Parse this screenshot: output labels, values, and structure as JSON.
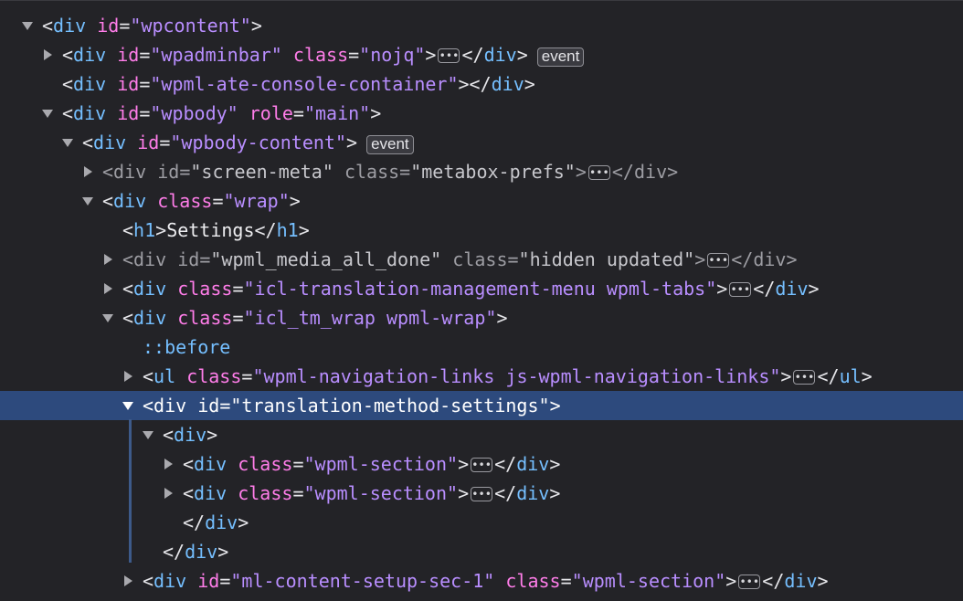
{
  "badges": {
    "event": "event"
  },
  "rows": [
    {
      "indent": 24,
      "twisty": "down",
      "dim": false,
      "selected": false,
      "parts": [
        [
          "b",
          "<"
        ],
        [
          "t",
          "div"
        ],
        [
          "s",
          " "
        ],
        [
          "a",
          "id"
        ],
        [
          "e",
          "="
        ],
        [
          "v",
          "\"wpcontent\""
        ],
        [
          "b",
          ">"
        ]
      ]
    },
    {
      "indent": 46,
      "twisty": "right",
      "dim": false,
      "selected": false,
      "parts": [
        [
          "b",
          "<"
        ],
        [
          "t",
          "div"
        ],
        [
          "s",
          " "
        ],
        [
          "a",
          "id"
        ],
        [
          "e",
          "="
        ],
        [
          "v",
          "\"wpadminbar\""
        ],
        [
          "s",
          " "
        ],
        [
          "a",
          "class"
        ],
        [
          "e",
          "="
        ],
        [
          "v",
          "\"nojq\""
        ],
        [
          "b",
          ">"
        ],
        [
          "ell",
          ""
        ],
        [
          "b",
          "</"
        ],
        [
          "t",
          "div"
        ],
        [
          "b",
          ">"
        ],
        [
          "badge",
          "event"
        ]
      ]
    },
    {
      "indent": 46,
      "twisty": "none",
      "dim": false,
      "selected": false,
      "parts": [
        [
          "b",
          "<"
        ],
        [
          "t",
          "div"
        ],
        [
          "s",
          " "
        ],
        [
          "a",
          "id"
        ],
        [
          "e",
          "="
        ],
        [
          "v",
          "\"wpml-ate-console-container\""
        ],
        [
          "b",
          "></"
        ],
        [
          "t",
          "div"
        ],
        [
          "b",
          ">"
        ]
      ]
    },
    {
      "indent": 46,
      "twisty": "down",
      "dim": false,
      "selected": false,
      "parts": [
        [
          "b",
          "<"
        ],
        [
          "t",
          "div"
        ],
        [
          "s",
          " "
        ],
        [
          "a",
          "id"
        ],
        [
          "e",
          "="
        ],
        [
          "v",
          "\"wpbody\""
        ],
        [
          "s",
          " "
        ],
        [
          "a",
          "role"
        ],
        [
          "e",
          "="
        ],
        [
          "v",
          "\"main\""
        ],
        [
          "b",
          ">"
        ]
      ]
    },
    {
      "indent": 68,
      "twisty": "down",
      "dim": false,
      "selected": false,
      "parts": [
        [
          "b",
          "<"
        ],
        [
          "t",
          "div"
        ],
        [
          "s",
          " "
        ],
        [
          "a",
          "id"
        ],
        [
          "e",
          "="
        ],
        [
          "v",
          "\"wpbody-content\""
        ],
        [
          "b",
          ">"
        ],
        [
          "badge",
          "event"
        ]
      ]
    },
    {
      "indent": 90,
      "twisty": "right",
      "dim": true,
      "selected": false,
      "parts": [
        [
          "b",
          "<"
        ],
        [
          "t",
          "div"
        ],
        [
          "s",
          " "
        ],
        [
          "a",
          "id"
        ],
        [
          "e",
          "="
        ],
        [
          "vd",
          "\"screen-meta\""
        ],
        [
          "s",
          " "
        ],
        [
          "a",
          "class"
        ],
        [
          "e",
          "="
        ],
        [
          "vd",
          "\"metabox-prefs\""
        ],
        [
          "b",
          ">"
        ],
        [
          "ell",
          ""
        ],
        [
          "b",
          "</"
        ],
        [
          "t",
          "div"
        ],
        [
          "b",
          ">"
        ]
      ]
    },
    {
      "indent": 90,
      "twisty": "down",
      "dim": false,
      "selected": false,
      "parts": [
        [
          "b",
          "<"
        ],
        [
          "t",
          "div"
        ],
        [
          "s",
          " "
        ],
        [
          "a",
          "class"
        ],
        [
          "e",
          "="
        ],
        [
          "v",
          "\"wrap\""
        ],
        [
          "b",
          ">"
        ]
      ]
    },
    {
      "indent": 112,
      "twisty": "none",
      "dim": false,
      "selected": false,
      "parts": [
        [
          "b",
          "<"
        ],
        [
          "t",
          "h1"
        ],
        [
          "b",
          ">"
        ],
        [
          "x",
          "Settings"
        ],
        [
          "b",
          "</"
        ],
        [
          "t",
          "h1"
        ],
        [
          "b",
          ">"
        ]
      ]
    },
    {
      "indent": 112,
      "twisty": "right",
      "dim": true,
      "selected": false,
      "parts": [
        [
          "b",
          "<"
        ],
        [
          "t",
          "div"
        ],
        [
          "s",
          " "
        ],
        [
          "a",
          "id"
        ],
        [
          "e",
          "="
        ],
        [
          "vd",
          "\"wpml_media_all_done\""
        ],
        [
          "s",
          " "
        ],
        [
          "a",
          "class"
        ],
        [
          "e",
          "="
        ],
        [
          "vd",
          "\"hidden updated\""
        ],
        [
          "b",
          ">"
        ],
        [
          "ell",
          ""
        ],
        [
          "b",
          "</"
        ],
        [
          "t",
          "div"
        ],
        [
          "b",
          ">"
        ]
      ]
    },
    {
      "indent": 112,
      "twisty": "right",
      "dim": false,
      "selected": false,
      "parts": [
        [
          "b",
          "<"
        ],
        [
          "t",
          "div"
        ],
        [
          "s",
          " "
        ],
        [
          "a",
          "class"
        ],
        [
          "e",
          "="
        ],
        [
          "v",
          "\"icl-translation-management-menu wpml-tabs\""
        ],
        [
          "b",
          ">"
        ],
        [
          "ell",
          ""
        ],
        [
          "b",
          "</"
        ],
        [
          "t",
          "div"
        ],
        [
          "b",
          ">"
        ]
      ]
    },
    {
      "indent": 112,
      "twisty": "down",
      "dim": false,
      "selected": false,
      "parts": [
        [
          "b",
          "<"
        ],
        [
          "t",
          "div"
        ],
        [
          "s",
          " "
        ],
        [
          "a",
          "class"
        ],
        [
          "e",
          "="
        ],
        [
          "v",
          "\"icl_tm_wrap wpml-wrap\""
        ],
        [
          "b",
          ">"
        ]
      ]
    },
    {
      "indent": 134,
      "twisty": "none",
      "dim": false,
      "selected": false,
      "parts": [
        [
          "p",
          "::before"
        ]
      ]
    },
    {
      "indent": 134,
      "twisty": "right",
      "dim": false,
      "selected": false,
      "parts": [
        [
          "b",
          "<"
        ],
        [
          "t",
          "ul"
        ],
        [
          "s",
          " "
        ],
        [
          "a",
          "class"
        ],
        [
          "e",
          "="
        ],
        [
          "v",
          "\"wpml-navigation-links js-wpml-navigation-links\""
        ],
        [
          "b",
          ">"
        ],
        [
          "ell",
          ""
        ],
        [
          "b",
          "</"
        ],
        [
          "t",
          "ul"
        ],
        [
          "b",
          ">"
        ]
      ]
    },
    {
      "indent": 134,
      "twisty": "down",
      "dim": false,
      "selected": true,
      "parts": [
        [
          "b",
          "<"
        ],
        [
          "t",
          "div"
        ],
        [
          "s",
          " "
        ],
        [
          "a",
          "id"
        ],
        [
          "e",
          "="
        ],
        [
          "v",
          "\"translation-method-settings\""
        ],
        [
          "b",
          ">"
        ]
      ]
    },
    {
      "indent": 156,
      "twisty": "down",
      "dim": false,
      "selected": false,
      "parts": [
        [
          "b",
          "<"
        ],
        [
          "t",
          "div"
        ],
        [
          "b",
          ">"
        ]
      ]
    },
    {
      "indent": 178,
      "twisty": "right",
      "dim": false,
      "selected": false,
      "parts": [
        [
          "b",
          "<"
        ],
        [
          "t",
          "div"
        ],
        [
          "s",
          " "
        ],
        [
          "a",
          "class"
        ],
        [
          "e",
          "="
        ],
        [
          "v",
          "\"wpml-section\""
        ],
        [
          "b",
          ">"
        ],
        [
          "ell",
          ""
        ],
        [
          "b",
          "</"
        ],
        [
          "t",
          "div"
        ],
        [
          "b",
          ">"
        ]
      ]
    },
    {
      "indent": 178,
      "twisty": "right",
      "dim": false,
      "selected": false,
      "parts": [
        [
          "b",
          "<"
        ],
        [
          "t",
          "div"
        ],
        [
          "s",
          " "
        ],
        [
          "a",
          "class"
        ],
        [
          "e",
          "="
        ],
        [
          "v",
          "\"wpml-section\""
        ],
        [
          "b",
          ">"
        ],
        [
          "ell",
          ""
        ],
        [
          "b",
          "</"
        ],
        [
          "t",
          "div"
        ],
        [
          "b",
          ">"
        ]
      ]
    },
    {
      "indent": 178,
      "twisty": "none",
      "dim": false,
      "selected": false,
      "parts": [
        [
          "b",
          "</"
        ],
        [
          "t",
          "div"
        ],
        [
          "b",
          ">"
        ]
      ]
    },
    {
      "indent": 156,
      "twisty": "none",
      "dim": false,
      "selected": false,
      "parts": [
        [
          "b",
          "</"
        ],
        [
          "t",
          "div"
        ],
        [
          "b",
          ">"
        ]
      ]
    },
    {
      "indent": 134,
      "twisty": "right",
      "dim": false,
      "selected": false,
      "parts": [
        [
          "b",
          "<"
        ],
        [
          "t",
          "div"
        ],
        [
          "s",
          " "
        ],
        [
          "a",
          "id"
        ],
        [
          "e",
          "="
        ],
        [
          "v",
          "\"ml-content-setup-sec-1\""
        ],
        [
          "s",
          " "
        ],
        [
          "a",
          "class"
        ],
        [
          "e",
          "="
        ],
        [
          "v",
          "\"wpml-section\""
        ],
        [
          "b",
          ">"
        ],
        [
          "ell",
          ""
        ],
        [
          "b",
          "</"
        ],
        [
          "t",
          "div"
        ],
        [
          "b",
          ">"
        ]
      ]
    }
  ]
}
